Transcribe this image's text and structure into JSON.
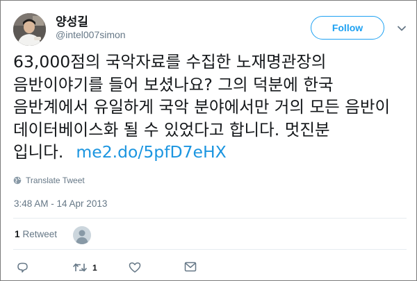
{
  "author": {
    "name": "양성길",
    "handle": "@intel007simon",
    "avatar_icon": "user-photo"
  },
  "follow_label": "Follow",
  "menu_icon": "chevron-down-icon",
  "tweet": {
    "text": "63,000점의 국악자료를 수집한 노재명관장의 음반이야기를 들어 보셨나요? 그의 덕분에 한국 음반계에서 유일하게 국악 분야에서만 거의 모든 음반이 데이터베이스화 될 수 있었다고 합니다. 멋진분 입니다.",
    "link": "me2.do/5pfD7eHX"
  },
  "translate_label": "Translate Tweet",
  "timestamp": "3:48 AM - 14 Apr 2013",
  "stats": {
    "retweet_count": "1",
    "retweet_label": "Retweet"
  },
  "actions": {
    "reply_count": "",
    "retweet_count": "1",
    "like_count": ""
  },
  "colors": {
    "accent": "#1da1f2",
    "link": "#1b95e0",
    "secondary_text": "#657786",
    "divider": "#e6ecf0"
  }
}
